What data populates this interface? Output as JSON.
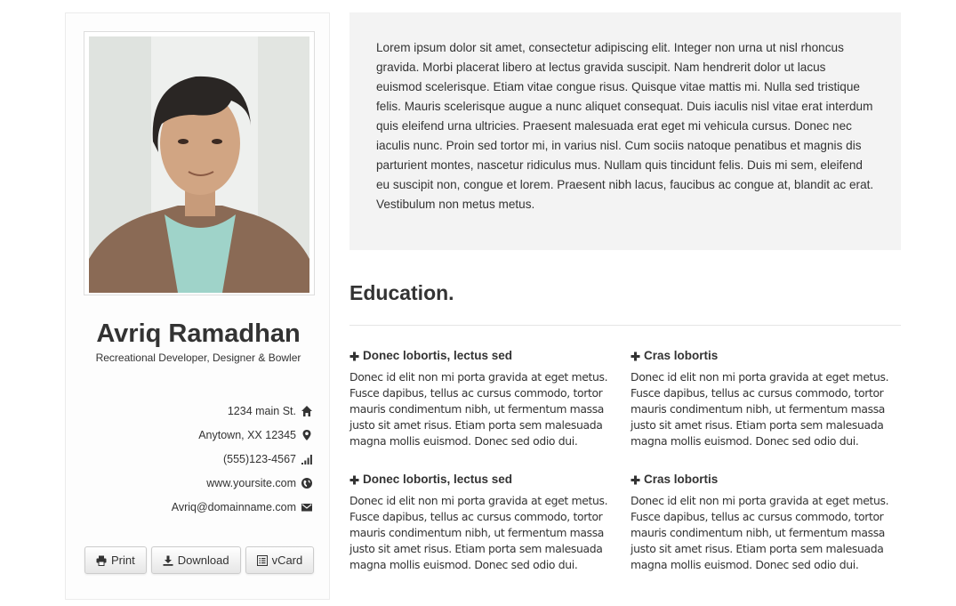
{
  "profile": {
    "name": "Avriq Ramadhan",
    "tagline": "Recreational Developer, Designer & Bowler",
    "photo_alt": "profile photo"
  },
  "contacts": [
    {
      "text": "1234 main St.",
      "icon": "home-icon"
    },
    {
      "text": "Anytown, XX 12345",
      "icon": "map-marker-icon"
    },
    {
      "text": "(555)123-4567",
      "icon": "signal-icon"
    },
    {
      "text": "www.yoursite.com",
      "icon": "globe-icon"
    },
    {
      "text": "Avriq@domainname.com",
      "icon": "envelope-icon"
    }
  ],
  "actions": {
    "print": "Print",
    "download": "Download",
    "vcard": "vCard"
  },
  "about": {
    "text": "Lorem ipsum dolor sit amet, consectetur adipiscing elit. Integer non urna ut nisl rhoncus gravida. Morbi placerat libero at lectus gravida suscipit. Nam hendrerit dolor ut lacus euismod scelerisque. Etiam vitae congue risus. Quisque vitae mattis mi. Nulla sed tristique felis. Mauris scelerisque augue a nunc aliquet consequat. Duis iaculis nisl vitae erat interdum quis eleifend urna ultricies. Praesent malesuada erat eget mi vehicula cursus. Donec nec iaculis nunc. Proin sed tortor mi, in varius nisl. Cum sociis natoque penatibus et magnis dis parturient montes, nascetur ridiculus mus. Nullam quis tincidunt felis. Duis mi sem, eleifend eu suscipit non, congue et lorem. Praesent nibh lacus, faucibus ac congue at, blandit ac erat. Vestibulum non metus metus."
  },
  "education": {
    "title": "Education.",
    "items": [
      {
        "heading": "Donec lobortis, lectus sed",
        "text": "Donec id elit non mi porta gravida at eget metus. Fusce dapibus, tellus ac cursus commodo, tortor mauris condimentum nibh, ut fermentum massa justo sit amet risus. Etiam porta sem malesuada magna mollis euismod. Donec sed odio dui."
      },
      {
        "heading": "Cras lobortis",
        "text": "Donec id elit non mi porta gravida at eget metus. Fusce dapibus, tellus ac cursus commodo, tortor mauris condimentum nibh, ut fermentum massa justo sit amet risus. Etiam porta sem malesuada magna mollis euismod. Donec sed odio dui."
      },
      {
        "heading": "Donec lobortis, lectus sed",
        "text": "Donec id elit non mi porta gravida at eget metus. Fusce dapibus, tellus ac cursus commodo, tortor mauris condimentum nibh, ut fermentum massa justo sit amet risus. Etiam porta sem malesuada magna mollis euismod. Donec sed odio dui."
      },
      {
        "heading": "Cras lobortis",
        "text": "Donec id elit non mi porta gravida at eget metus. Fusce dapibus, tellus ac cursus commodo, tortor mauris condimentum nibh, ut fermentum massa justo sit amet risus. Etiam porta sem malesuada magna mollis euismod. Donec sed odio dui."
      }
    ]
  },
  "colors": {
    "text": "#333333",
    "panel_bg": "#f3f3f3",
    "border": "#dddddd"
  }
}
